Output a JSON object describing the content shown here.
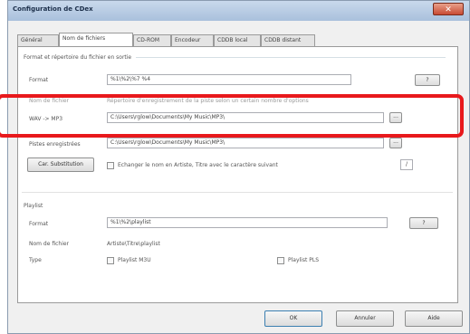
{
  "window": {
    "title": "Configuration de CDex",
    "close_glyph": "✕"
  },
  "tabs": [
    "Général",
    "Nom de fichiers",
    "CD-ROM",
    "Encodeur",
    "CDDB local",
    "CDDB distant"
  ],
  "section_format": {
    "caption": "Format et répertoire du fichier en sortie",
    "format_label": "Format",
    "format_value": "%1\\%2\\%7 %4",
    "format_button": "?",
    "filename_label": "Nom de fichier",
    "filename_hint": "Répertoire d'enregistrement de la piste selon un certain nombre d'options",
    "wav_mp3_label": "WAV -> MP3",
    "wav_mp3_value": "C:\\Users\\rglow\\Documents\\My Music\\MP3\\",
    "wav_mp3_button": "...",
    "recorded_label": "Pistes enregistrées",
    "recorded_value": "C:\\Users\\rglow\\Documents\\My Music\\MP3\\",
    "recorded_button": "...",
    "char_sub_button": "Car. Substitution",
    "checkbox_label": "Echanger le nom en Artiste, Titre avec le caractère suivant",
    "char_value": "/"
  },
  "section_playlist": {
    "caption": "Playlist",
    "format_label": "Format",
    "format_value": "%1\\%2\\playlist",
    "format_button": "?",
    "filename_label": "Nom de fichier",
    "filename_value": "Artiste\\Titre\\playlist",
    "type_label": "Type",
    "m3u_label": "Playlist M3U",
    "pls_label": "Playlist PLS"
  },
  "buttons": {
    "ok": "OK",
    "cancel": "Annuler",
    "help": "Aide"
  },
  "colors": {
    "highlight": "#e8191c",
    "titlebar": "#a9c0dc"
  }
}
